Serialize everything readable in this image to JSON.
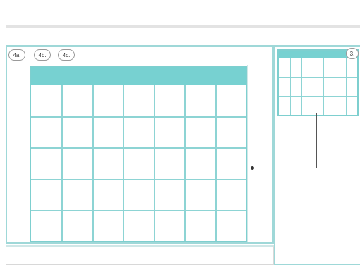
{
  "tabs": [
    {
      "label": "4a."
    },
    {
      "label": "4b."
    },
    {
      "label": "4c."
    }
  ],
  "callout": {
    "label": "3."
  },
  "calendar": {
    "columns": 7,
    "rows": 5
  },
  "mini_calendar": {
    "columns": 7,
    "rows": 6
  },
  "colors": {
    "accent": "#77d1d1",
    "grid": "#8dd4d4",
    "panel_border": "#9fd8d8",
    "connector": "#555555"
  }
}
